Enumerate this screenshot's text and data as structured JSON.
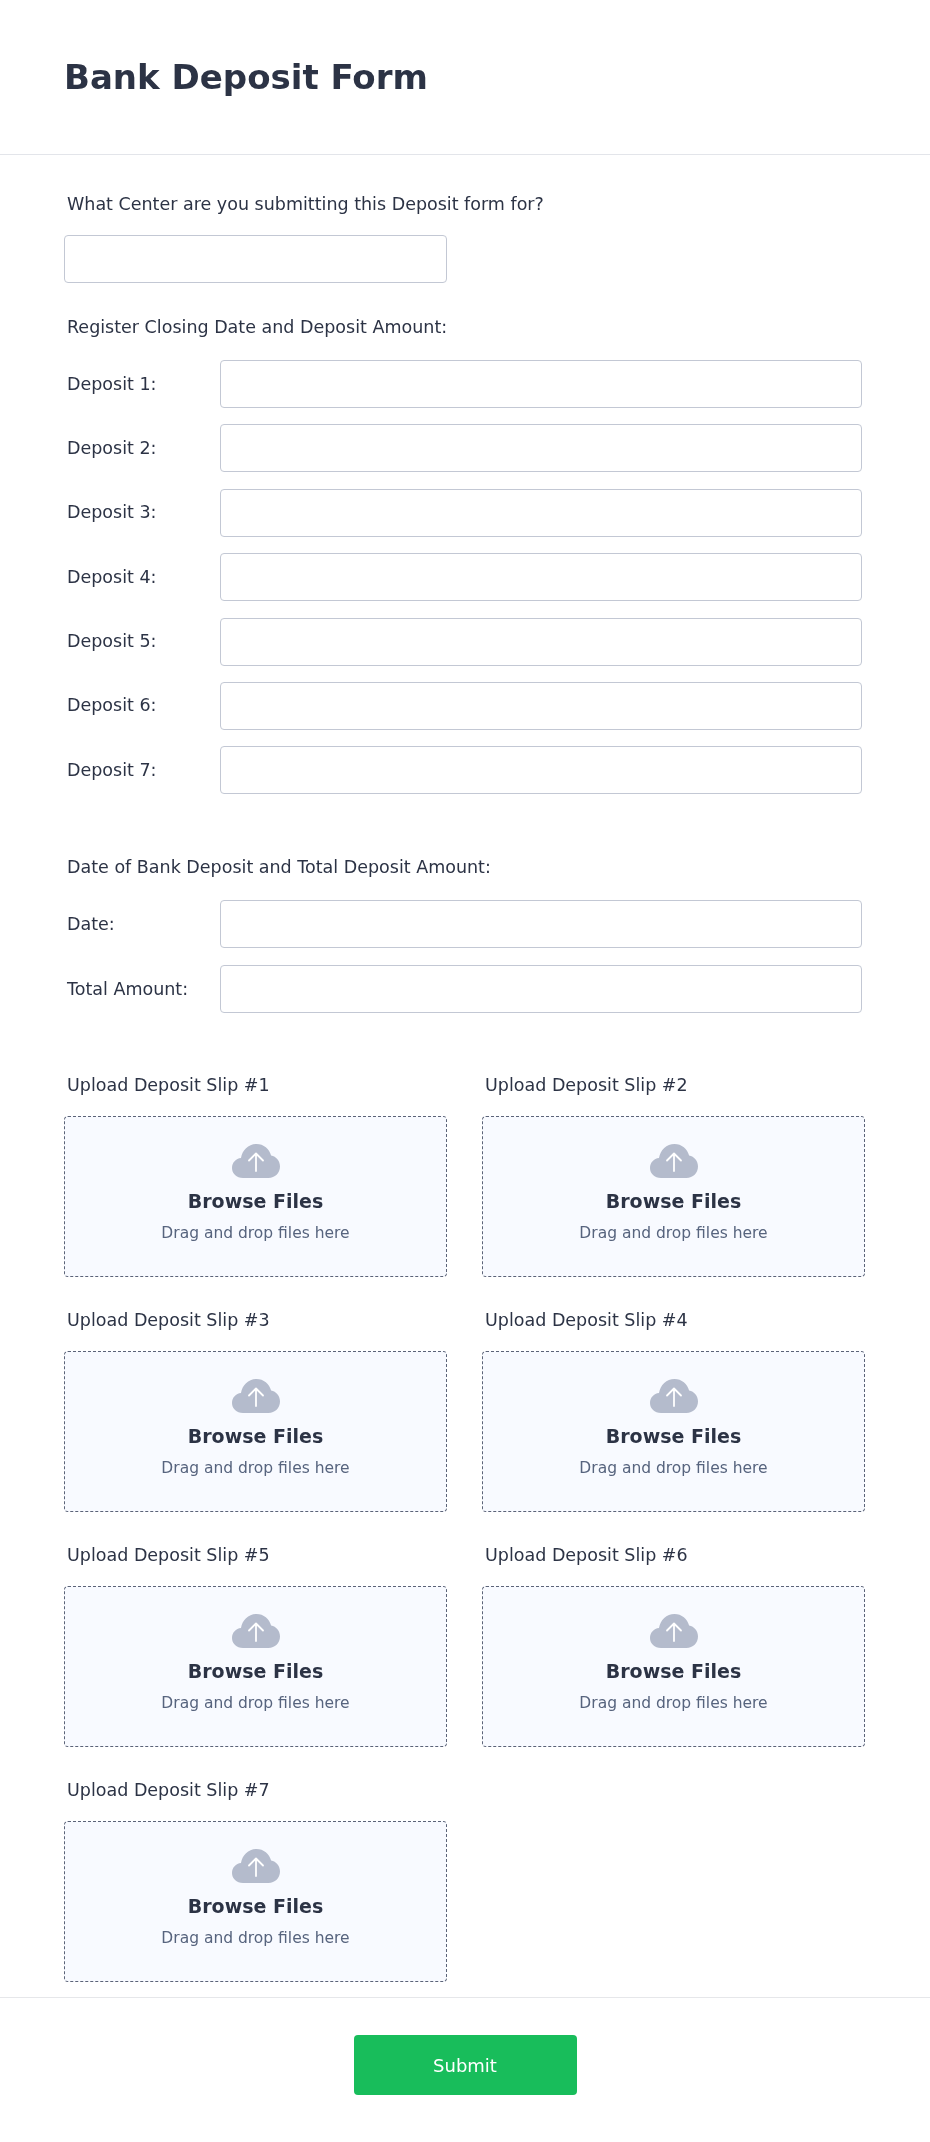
{
  "form_title": "Bank Deposit Form",
  "center_field": {
    "label": "What Center are you submitting this Deposit form for?"
  },
  "register_section": {
    "heading": "Register Closing Date and Deposit Amount:",
    "fields": [
      {
        "label": "Deposit 1:"
      },
      {
        "label": "Deposit 2:"
      },
      {
        "label": "Deposit 3:"
      },
      {
        "label": "Deposit 4:"
      },
      {
        "label": "Deposit 5:"
      },
      {
        "label": "Deposit 6:"
      },
      {
        "label": "Deposit 7:"
      }
    ]
  },
  "bank_deposit_section": {
    "heading": "Date of Bank Deposit and Total Deposit Amount:",
    "fields": [
      {
        "label": "Date:"
      },
      {
        "label": "Total Amount:"
      }
    ]
  },
  "uploads": [
    {
      "label": "Upload Deposit Slip #1",
      "button": "Browse Files",
      "hint": "Drag and drop files here"
    },
    {
      "label": "Upload Deposit Slip #2",
      "button": "Browse Files",
      "hint": "Drag and drop files here"
    },
    {
      "label": "Upload Deposit Slip #3",
      "button": "Browse Files",
      "hint": "Drag and drop files here"
    },
    {
      "label": "Upload Deposit Slip #4",
      "button": "Browse Files",
      "hint": "Drag and drop files here"
    },
    {
      "label": "Upload Deposit Slip #5",
      "button": "Browse Files",
      "hint": "Drag and drop files here"
    },
    {
      "label": "Upload Deposit Slip #6",
      "button": "Browse Files",
      "hint": "Drag and drop files here"
    },
    {
      "label": "Upload Deposit Slip #7",
      "button": "Browse Files",
      "hint": "Drag and drop files here"
    }
  ],
  "submit_button": "Submit"
}
